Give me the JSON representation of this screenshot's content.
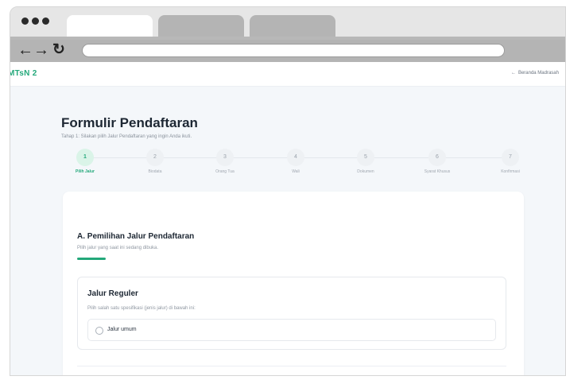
{
  "browser": {
    "address_value": ""
  },
  "header": {
    "brand": "MTsN 2",
    "back_link": "Beranda Madrasah"
  },
  "form": {
    "title": "Formulir Pendaftaran",
    "subtitle": "Tahap 1: Silakan pilih Jalur Pendaftaran yang ingin Anda ikuti."
  },
  "steps": [
    {
      "number": "1",
      "label": "Pilih Jalur",
      "active": true
    },
    {
      "number": "2",
      "label": "Biodata",
      "active": false
    },
    {
      "number": "3",
      "label": "Orang Tua",
      "active": false
    },
    {
      "number": "4",
      "label": "Wali",
      "active": false
    },
    {
      "number": "5",
      "label": "Dokumen",
      "active": false
    },
    {
      "number": "6",
      "label": "Syarat Khusus",
      "active": false
    },
    {
      "number": "7",
      "label": "Konfirmasi",
      "active": false
    }
  ],
  "section": {
    "title": "A. Pemilihan Jalur Pendaftaran",
    "subtitle": "Pilih jalur yang saat ini sedang dibuka."
  },
  "route": {
    "title": "Jalur Reguler",
    "hint": "Pilih salah satu spesifikasi (jenis jalur) di bawah ini:",
    "option_label": "Jalur umum"
  },
  "colors": {
    "accent": "#23a87a",
    "text_dark": "#1d2733",
    "muted": "#8f97a1"
  },
  "icons": {
    "back": "arrow-left-icon",
    "nav_back": "arrow-left-icon",
    "nav_forward": "arrow-right-icon",
    "reload": "reload-icon"
  }
}
